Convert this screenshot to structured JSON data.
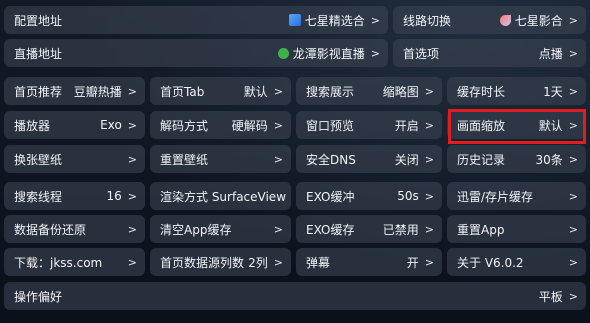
{
  "rows": [
    [
      {
        "label": "配置地址",
        "value": "七星精选合",
        "icon": "cube-icon"
      },
      {
        "label": "线路切换",
        "value": "七星影合",
        "icon": "rocket-icon"
      }
    ],
    [
      {
        "label": "直播地址",
        "value": "龙潭影视直播",
        "icon": "dragon-icon"
      },
      {
        "label": "首选项",
        "value": "点播"
      }
    ],
    [
      {
        "label": "首页推荐",
        "value": "豆瓣热播"
      },
      {
        "label": "首页Tab",
        "value": "默认"
      },
      {
        "label": "搜索展示",
        "value": "缩略图"
      },
      {
        "label": "缓存时长",
        "value": "1天"
      }
    ],
    [
      {
        "label": "播放器",
        "value": "Exo"
      },
      {
        "label": "解码方式",
        "value": "硬解码"
      },
      {
        "label": "窗口预览",
        "value": "开启"
      },
      {
        "label": "画面缩放",
        "value": "默认"
      }
    ],
    [
      {
        "label": "换张壁纸",
        "value": ""
      },
      {
        "label": "重置壁纸",
        "value": ""
      },
      {
        "label": "安全DNS",
        "value": "关闭"
      },
      {
        "label": "历史记录",
        "value": "30条"
      }
    ],
    [
      {
        "label": "搜索线程",
        "value": "16"
      },
      {
        "label": "渲染方式 SurfaceView",
        "value": ""
      },
      {
        "label": "EXO缓冲",
        "value": "50s"
      },
      {
        "label": "迅雷/存片缓存",
        "value": ""
      }
    ],
    [
      {
        "label": "数据备份还原",
        "value": ""
      },
      {
        "label": "清空App缓存",
        "value": ""
      },
      {
        "label": "EXO缓存",
        "value": "已禁用"
      },
      {
        "label": "重置App",
        "value": ""
      }
    ],
    [
      {
        "label": "下载：jkss.com",
        "value": ""
      },
      {
        "label": "首页数据源列数",
        "value": "2列"
      },
      {
        "label": "弹幕",
        "value": "开"
      },
      {
        "label": "关于  V6.0.2",
        "value": ""
      }
    ],
    [
      {
        "label": "操作偏好",
        "value": "平板"
      }
    ]
  ],
  "chevron": ">",
  "highlight_color": "#e01e1e"
}
